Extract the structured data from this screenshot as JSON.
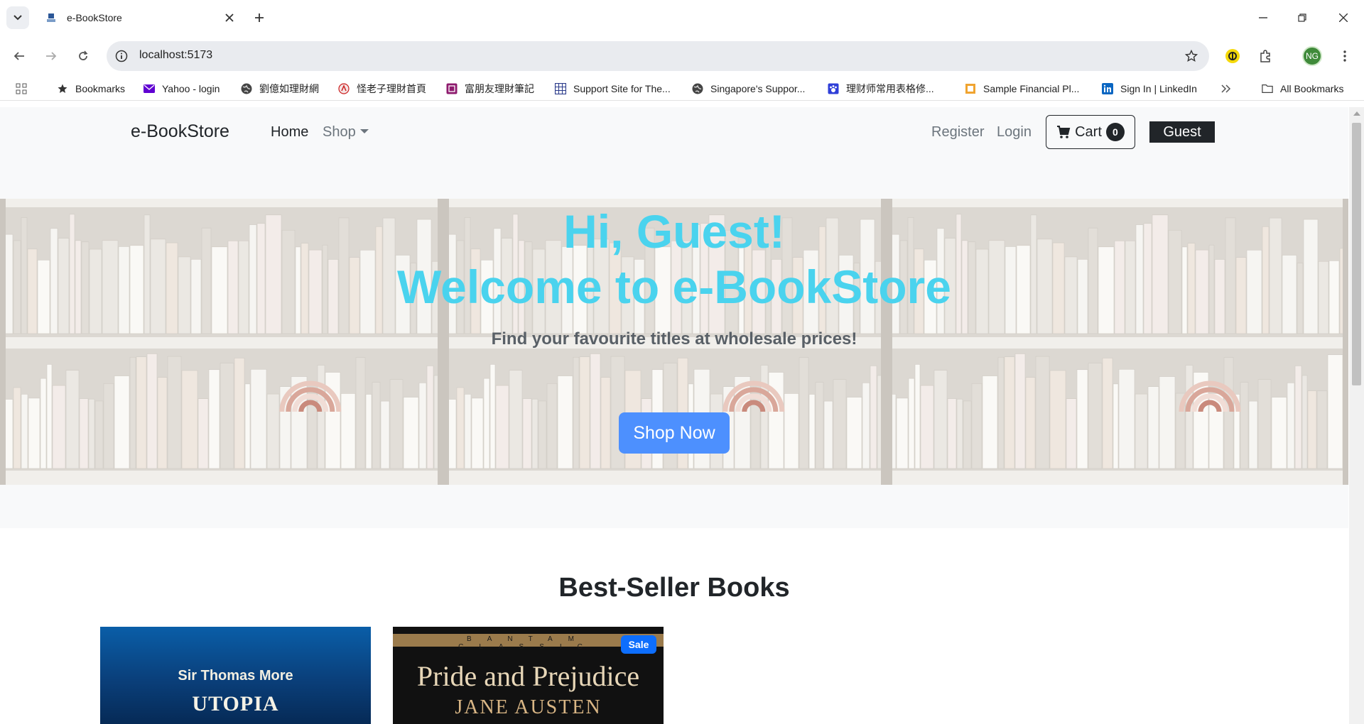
{
  "browser": {
    "tab_title": "e-BookStore",
    "url": "localhost:5173",
    "profile_initials": "NG",
    "bookmarks": [
      {
        "label": "Bookmarks",
        "icon": "star-icon"
      },
      {
        "label": "Yahoo - login",
        "icon": "yahoo-mail-icon"
      },
      {
        "label": "劉億如理財網",
        "icon": "globe-icon"
      },
      {
        "label": "怪老子理財首頁",
        "icon": "site-logo-icon"
      },
      {
        "label": "富朋友理財筆記",
        "icon": "site-logo-icon"
      },
      {
        "label": "Support Site for The...",
        "icon": "grid-site-icon"
      },
      {
        "label": "Singapore's Suppor...",
        "icon": "globe-icon"
      },
      {
        "label": "理财师常用表格修...",
        "icon": "paw-icon"
      },
      {
        "label": "Sample Financial Pl...",
        "icon": "site-logo-icon"
      },
      {
        "label": "Sign In | LinkedIn",
        "icon": "linkedin-icon"
      }
    ],
    "all_bookmarks": "All Bookmarks"
  },
  "navbar": {
    "brand": "e-BookStore",
    "home": "Home",
    "shop": "Shop",
    "register": "Register",
    "login": "Login",
    "cart_label": "Cart",
    "cart_count": "0",
    "user": "Guest"
  },
  "hero": {
    "greeting": "Hi, Guest!",
    "welcome": "Welcome to e-BookStore",
    "subtitle": "Find your favourite titles at wholesale prices!",
    "cta": "Shop Now"
  },
  "bestsellers": {
    "title": "Best-Seller Books",
    "books": [
      {
        "author": "Sir Thomas More",
        "title": "UTOPIA",
        "badge": ""
      },
      {
        "author": "JANE AUSTEN",
        "title": "Pride and Prejudice",
        "series": "BANTAM CLASSIC",
        "badge": "Sale"
      }
    ]
  },
  "colors": {
    "hero_text": "#4ad3ee",
    "cta_bg": "#4d90fe",
    "sale_badge": "#0d6efd",
    "nav_bg": "#f8f9fa",
    "dark": "#212529"
  }
}
